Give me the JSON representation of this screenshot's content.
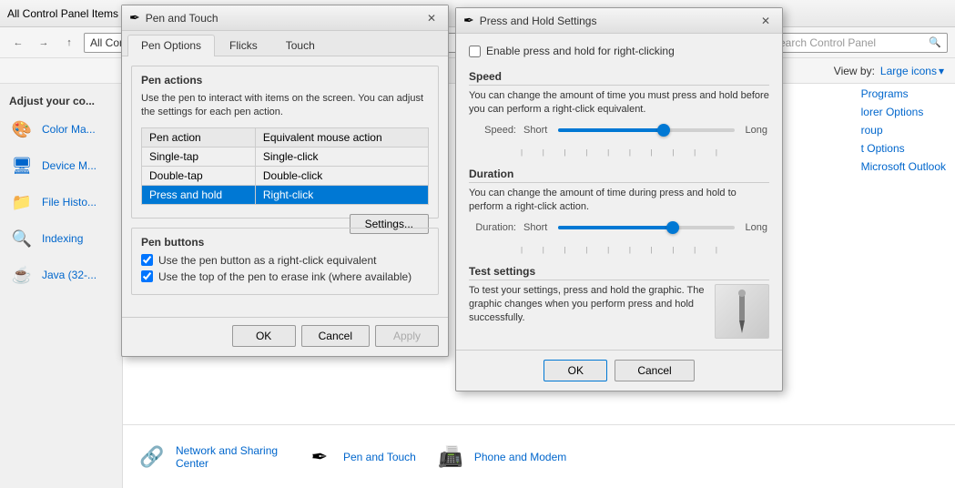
{
  "controlPanel": {
    "title": "All Control Panel Items",
    "searchPlaceholder": "Search Control Panel",
    "viewByLabel": "View by:",
    "viewByValue": "Large icons",
    "navBack": "←",
    "navForward": "→",
    "navUp": "↑",
    "navRefresh": "⟳",
    "addressBarText": "All Control Panel I...",
    "sidebarHeading": "Adjust your co...",
    "sidebarItems": [
      {
        "id": "color-management",
        "icon": "🎨",
        "label": "Color Ma..."
      },
      {
        "id": "device-manager",
        "icon": "🖥",
        "label": "Device M..."
      },
      {
        "id": "file-history",
        "icon": "📁",
        "label": "File Histo..."
      },
      {
        "id": "indexing",
        "icon": "🔍",
        "label": "Indexing"
      },
      {
        "id": "java",
        "icon": "☕",
        "label": "Java (32-..."
      }
    ],
    "bottomItems": [
      {
        "id": "network-sharing",
        "icon": "🔗",
        "label": "Network and Sharing Center"
      },
      {
        "id": "pen-touch",
        "icon": "✒",
        "label": "Pen and Touch"
      },
      {
        "id": "phone-modem",
        "icon": "📠",
        "label": "Phone and Modem"
      }
    ]
  },
  "penTouchWindow": {
    "title": "Pen and Touch",
    "icon": "✒",
    "tabs": [
      {
        "id": "pen-options",
        "label": "Pen Options",
        "active": true
      },
      {
        "id": "flicks",
        "label": "Flicks"
      },
      {
        "id": "touch",
        "label": "Touch"
      }
    ],
    "penActionsSection": {
      "legend": "Pen actions",
      "description": "Use the pen to interact with items on the screen.  You can adjust the settings for each pen action.",
      "tableHeaders": [
        "Pen action",
        "Equivalent mouse action"
      ],
      "tableRows": [
        {
          "action": "Single-tap",
          "mouse": "Single-click",
          "selected": false
        },
        {
          "action": "Double-tap",
          "mouse": "Double-click",
          "selected": false
        },
        {
          "action": "Press and hold",
          "mouse": "Right-click",
          "selected": true
        }
      ],
      "settingsBtn": "Settings..."
    },
    "penButtonsSection": {
      "legend": "Pen buttons",
      "checkboxes": [
        {
          "id": "right-click-equiv",
          "checked": true,
          "label": "Use the pen button as a right-click equivalent"
        },
        {
          "id": "erase-ink",
          "checked": true,
          "label": "Use the top of the pen to erase ink (where available)"
        }
      ]
    },
    "footer": {
      "okBtn": "OK",
      "cancelBtn": "Cancel",
      "applyBtn": "Apply"
    }
  },
  "pressHoldWindow": {
    "title": "Press and Hold Settings",
    "icon": "✒",
    "enableCheckbox": {
      "checked": false,
      "label": "Enable press and hold for right-clicking"
    },
    "speedSection": {
      "title": "Speed",
      "description": "You can change the amount of time you must press and hold before you can perform a right-click equivalent.",
      "sliderLabel": "Speed:",
      "leftLabel": "Short",
      "rightLabel": "Long",
      "sliderPercent": 60,
      "ticks": 10
    },
    "durationSection": {
      "title": "Duration",
      "description": "You can change the amount of time during press and hold to perform a right-click action.",
      "sliderLabel": "Duration:",
      "leftLabel": "Short",
      "rightLabel": "Long",
      "sliderPercent": 65,
      "ticks": 10
    },
    "testSection": {
      "title": "Test settings",
      "description": "To test your settings, press and hold the graphic. The graphic changes when you perform press and hold successfully."
    },
    "footer": {
      "okBtn": "OK",
      "cancelBtn": "Cancel"
    }
  }
}
